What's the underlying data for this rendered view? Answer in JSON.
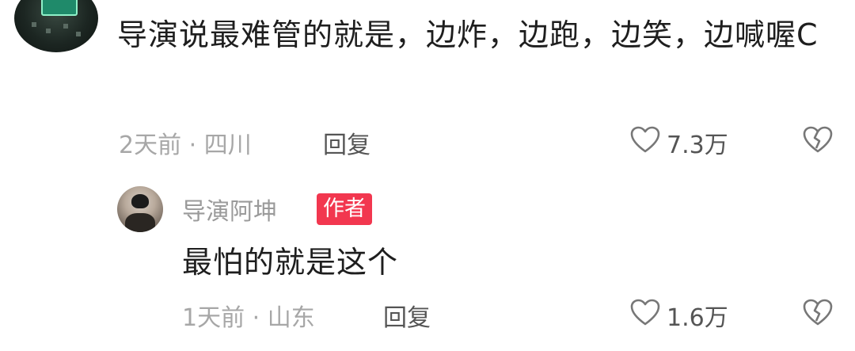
{
  "comment": {
    "text": "导演说最难管的就是，边炸，边跑，边笑，边喊喔C",
    "meta": "2天前 · 四川",
    "reply_label": "回复",
    "like_count": "7.3万"
  },
  "reply": {
    "author_name": "导演阿坤",
    "author_badge": "作者",
    "text": "最怕的就是这个",
    "meta": "1天前 · 山东",
    "reply_label": "回复",
    "like_count": "1.6万"
  },
  "icons": {
    "like": "heart-outline-icon",
    "dislike": "broken-heart-icon"
  }
}
